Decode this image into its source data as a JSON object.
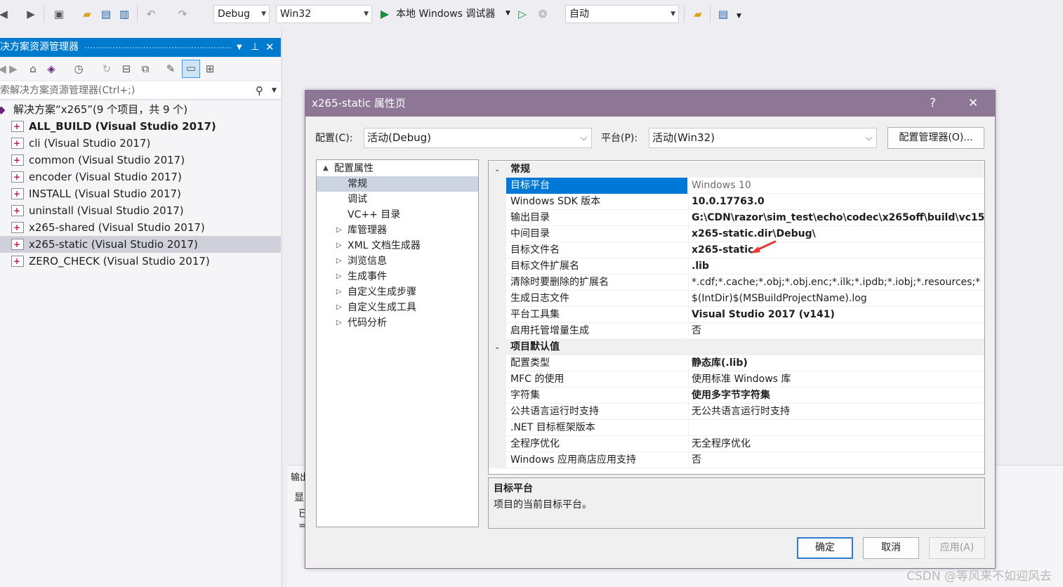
{
  "toolbar": {
    "config": "Debug",
    "platform": "Win32",
    "debugger": "本地 Windows 调试器",
    "mode": "自动"
  },
  "explorer": {
    "title": "决方案资源管理器",
    "search_placeholder": "索解决方案资源管理器(Ctrl+;)",
    "solution": "解决方案“x265”(9 个项目，共 9 个)",
    "projects": [
      {
        "label": "ALL_BUILD (Visual Studio 2017)",
        "bold": true
      },
      {
        "label": "cli (Visual Studio 2017)"
      },
      {
        "label": "common (Visual Studio 2017)"
      },
      {
        "label": "encoder (Visual Studio 2017)"
      },
      {
        "label": "INSTALL (Visual Studio 2017)"
      },
      {
        "label": "uninstall (Visual Studio 2017)"
      },
      {
        "label": "x265-shared (Visual Studio 2017)"
      },
      {
        "label": "x265-static (Visual Studio 2017)",
        "selected": true
      },
      {
        "label": "ZERO_CHECK (Visual Studio 2017)"
      }
    ]
  },
  "output": {
    "label": "输出",
    "line1": "显",
    "line2": "已",
    "line3": "="
  },
  "dialog": {
    "title": "x265-static 属性页",
    "help": "?",
    "close": "✕",
    "config_label": "配置(C):",
    "config_value": "活动(Debug)",
    "platform_label": "平台(P):",
    "platform_value": "活动(Win32)",
    "config_manager": "配置管理器(O)...",
    "tree": [
      {
        "label": "配置属性",
        "level": 0,
        "caret": "▲"
      },
      {
        "label": "常规",
        "level": 1,
        "selected": true
      },
      {
        "label": "调试",
        "level": 1
      },
      {
        "label": "VC++ 目录",
        "level": 1
      },
      {
        "label": "库管理器",
        "level": 1,
        "caret": "▷"
      },
      {
        "label": "XML 文档生成器",
        "level": 1,
        "caret": "▷"
      },
      {
        "label": "浏览信息",
        "level": 1,
        "caret": "▷"
      },
      {
        "label": "生成事件",
        "level": 1,
        "caret": "▷"
      },
      {
        "label": "自定义生成步骤",
        "level": 1,
        "caret": "▷"
      },
      {
        "label": "自定义生成工具",
        "level": 1,
        "caret": "▷"
      },
      {
        "label": "代码分析",
        "level": 1,
        "caret": "▷"
      }
    ],
    "grid": {
      "sections": [
        {
          "title": "常规",
          "rows": [
            {
              "name": "目标平台",
              "value": "Windows 10",
              "style": "gray",
              "selected": true
            },
            {
              "name": "Windows SDK 版本",
              "value": "10.0.17763.0",
              "style": "bold"
            },
            {
              "name": "输出目录",
              "value": "G:\\CDN\\razor\\sim_test\\echo\\codec\\x265off\\build\\vc15",
              "style": "bold"
            },
            {
              "name": "中间目录",
              "value": "x265-static.dir\\Debug\\",
              "style": "bold"
            },
            {
              "name": "目标文件名",
              "value": "x265-static",
              "style": "bold"
            },
            {
              "name": "目标文件扩展名",
              "value": ".lib",
              "style": "bold"
            },
            {
              "name": "清除时要删除的扩展名",
              "value": "*.cdf;*.cache;*.obj;*.obj.enc;*.ilk;*.ipdb;*.iobj;*.resources;*",
              "style": ""
            },
            {
              "name": "生成日志文件",
              "value": "$(IntDir)$(MSBuildProjectName).log",
              "style": ""
            },
            {
              "name": "平台工具集",
              "value": "Visual Studio 2017 (v141)",
              "style": "bold"
            },
            {
              "name": "启用托管增量生成",
              "value": "否",
              "style": ""
            }
          ]
        },
        {
          "title": "项目默认值",
          "rows": [
            {
              "name": "配置类型",
              "value": "静态库(.lib)",
              "style": "bold"
            },
            {
              "name": "MFC 的使用",
              "value": "使用标准 Windows 库",
              "style": ""
            },
            {
              "name": "字符集",
              "value": "使用多字节字符集",
              "style": "bold"
            },
            {
              "name": "公共语言运行时支持",
              "value": "无公共语言运行时支持",
              "style": ""
            },
            {
              "name": ".NET 目标框架版本",
              "value": "",
              "style": ""
            },
            {
              "name": "全程序优化",
              "value": "无全程序优化",
              "style": ""
            },
            {
              "name": "Windows 应用商店应用支持",
              "value": "否",
              "style": ""
            }
          ]
        }
      ]
    },
    "description": {
      "title": "目标平台",
      "text": "项目的当前目标平台。"
    },
    "ok": "确定",
    "cancel": "取消",
    "apply": "应用(A)"
  },
  "watermark": "CSDN @等风来不如迎风去",
  "colors": {
    "accent": "#007acc",
    "dialog_title": "#8e7697",
    "selection": "#0078d7",
    "annotation_arrow": "#e53935"
  }
}
